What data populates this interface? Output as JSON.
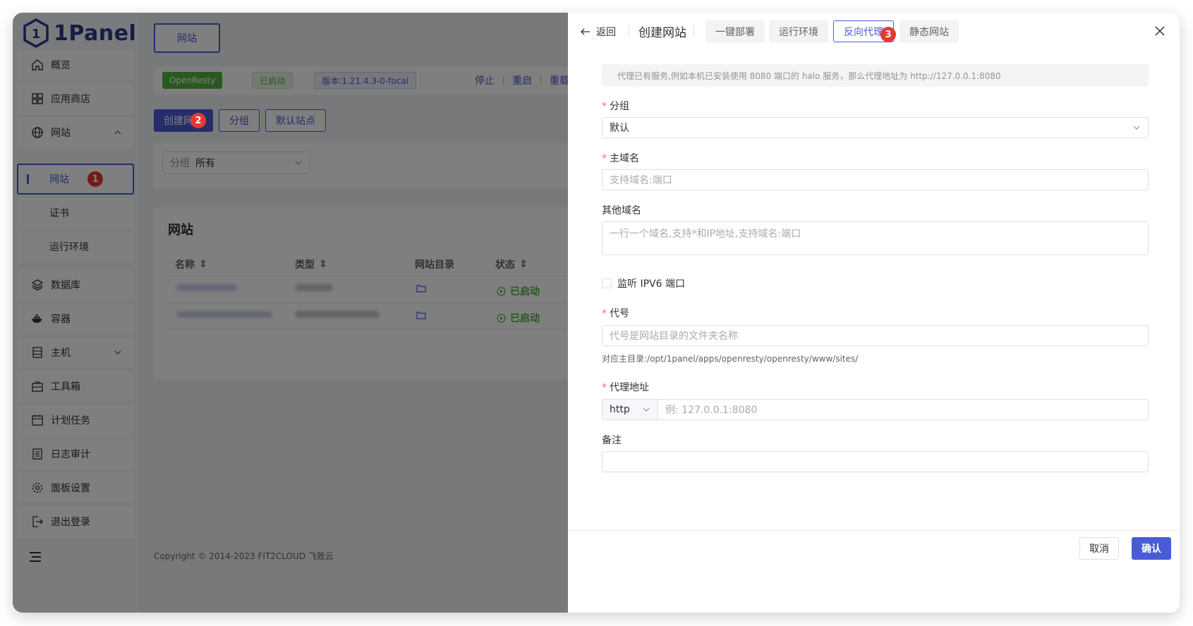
{
  "sidebar": {
    "logo_text": "1Panel",
    "items": [
      {
        "label": "概览",
        "icon": "home-icon"
      },
      {
        "label": "应用商店",
        "icon": "grid-icon"
      },
      {
        "label": "网站",
        "icon": "globe-icon"
      },
      {
        "label": "数据库",
        "icon": "layers-icon"
      },
      {
        "label": "容器",
        "icon": "docker-icon"
      },
      {
        "label": "主机",
        "icon": "server-icon"
      },
      {
        "label": "工具箱",
        "icon": "toolbox-icon"
      },
      {
        "label": "计划任务",
        "icon": "calendar-icon"
      },
      {
        "label": "日志审计",
        "icon": "log-icon"
      },
      {
        "label": "面板设置",
        "icon": "gear-icon"
      },
      {
        "label": "退出登录",
        "icon": "logout-icon"
      }
    ],
    "submenu": [
      "网站",
      "证书",
      "运行环境"
    ],
    "badge_1": "1"
  },
  "main": {
    "top_tab": "网站",
    "status": {
      "app": "OpenResty",
      "state": "已启动",
      "version": "版本:1.21.4.3-0-focal",
      "actions": [
        "停止",
        "重启",
        "重载"
      ]
    },
    "buttons": {
      "create": "创建网站",
      "group": "分组",
      "default_site": "默认站点"
    },
    "badge_2": "2",
    "filter": {
      "label": "分组",
      "value": "所有"
    },
    "table": {
      "title": "网站",
      "columns": [
        "名称",
        "类型",
        "网站目录",
        "状态"
      ],
      "rows": [
        {
          "status": "已启动"
        },
        {
          "status": "已启动"
        }
      ]
    },
    "copyright": "Copyright © 2014-2023 FIT2CLOUD 飞致云"
  },
  "drawer": {
    "back": "返回",
    "title": "创建网站",
    "tabs": [
      "一键部署",
      "运行环境",
      "反向代理",
      "静态网站"
    ],
    "active_tab": "反向代理",
    "badge_3": "3",
    "hint": "代理已有服务,例如本机已安装使用 8080 端口的 halo 服务，那么代理地址为 http://127.0.0.1:8080",
    "group": {
      "label": "分组",
      "value": "默认"
    },
    "primary_domain": {
      "label": "主域名",
      "placeholder": "支持域名:端口"
    },
    "other_domains": {
      "label": "其他域名",
      "placeholder": "一行一个域名,支持*和IP地址,支持域名:端口"
    },
    "ipv6": {
      "label": "监听 IPV6 端口"
    },
    "alias": {
      "label": "代号",
      "placeholder": "代号是网站目录的文件夹名称",
      "help": "对应主目录:/opt/1panel/apps/openresty/openresty/www/sites/"
    },
    "proxy": {
      "label": "代理地址",
      "protocol": "http",
      "placeholder": "例: 127.0.0.1:8080"
    },
    "remark": {
      "label": "备注"
    },
    "cancel": "取消",
    "confirm": "确认"
  },
  "colors": {
    "accent": "#4a5bd6",
    "success": "#52b043",
    "badge": "#e53935"
  }
}
